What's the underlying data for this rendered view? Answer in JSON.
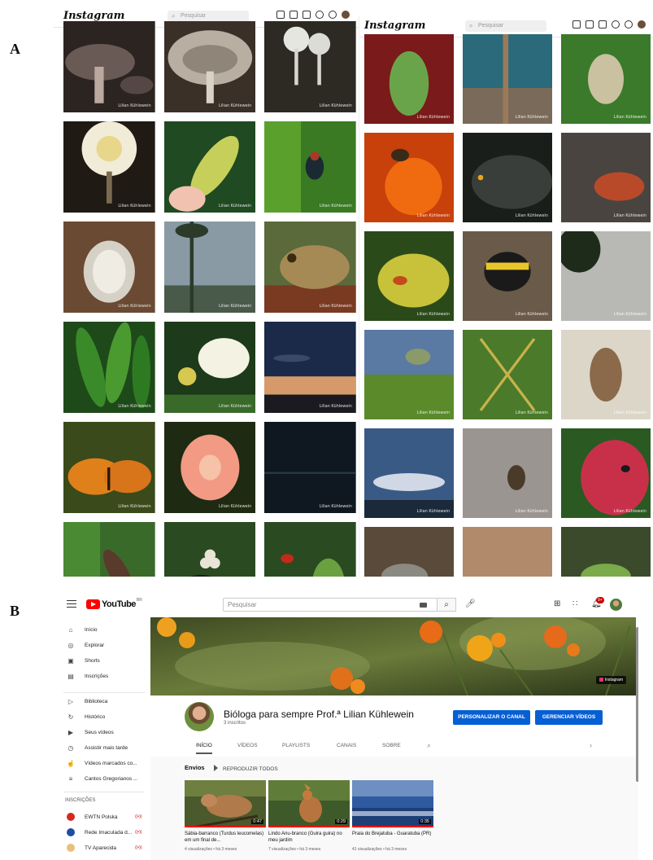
{
  "panels": {
    "a": "A",
    "b": "B"
  },
  "instagram": {
    "logo": "Instagram",
    "search_placeholder": "Pesquisar",
    "left_tiles": [
      {
        "id": "l1",
        "subject": "brown mushrooms",
        "watermark": "Lilian Kühlewein"
      },
      {
        "id": "l2",
        "subject": "mushroom gills",
        "watermark": "Lilian Kühlewein"
      },
      {
        "id": "l3",
        "subject": "white fungi",
        "watermark": "Lilian Kühlewein"
      },
      {
        "id": "l4",
        "subject": "white mushroom",
        "watermark": "Lilian Kühlewein"
      },
      {
        "id": "l5",
        "subject": "leaf in hand",
        "watermark": "Lilian Kühlewein"
      },
      {
        "id": "l6",
        "subject": "fly on leaf",
        "watermark": "Lilian Kühlewein"
      },
      {
        "id": "l7",
        "subject": "insect eggs",
        "watermark": "Lilian Kühlewein"
      },
      {
        "id": "l8",
        "subject": "palm and sky",
        "watermark": "Lilian Kühlewein"
      },
      {
        "id": "l9",
        "subject": "frog",
        "watermark": "Lilian Kühlewein"
      },
      {
        "id": "l10",
        "subject": "green leaves",
        "watermark": "Lilian Kühlewein"
      },
      {
        "id": "l11",
        "subject": "white butterfly",
        "watermark": "Lilian Kühlewein"
      },
      {
        "id": "l12",
        "subject": "sunset sky",
        "watermark": "Lilian Kühlewein"
      },
      {
        "id": "l13",
        "subject": "orange butterfly",
        "watermark": "Lilian Kühlewein"
      },
      {
        "id": "l14",
        "subject": "pink flower",
        "watermark": "Lilian Kühlewein"
      },
      {
        "id": "l15",
        "subject": "dark night",
        "watermark": "Lilian Kühlewein"
      },
      {
        "id": "l16",
        "subject": "bug on stem",
        "watermark": "Lilian Kühlewein"
      },
      {
        "id": "l17",
        "subject": "beetle with eggs",
        "watermark": "Lilian Kühlewein"
      },
      {
        "id": "l18",
        "subject": "red insect",
        "watermark": "Lilian Kühlewein"
      }
    ],
    "right_tiles": [
      {
        "id": "r1",
        "subject": "green insect",
        "watermark": "Lilian Kühlewein"
      },
      {
        "id": "r2",
        "subject": "stick insect",
        "watermark": "Lilian Kühlewein"
      },
      {
        "id": "r3",
        "subject": "stink bug",
        "watermark": "Lilian Kühlewein"
      },
      {
        "id": "r4",
        "subject": "bee on orange flower",
        "watermark": "Lilian Kühlewein"
      },
      {
        "id": "r5",
        "subject": "dark leaf",
        "watermark": "Lilian Kühlewein"
      },
      {
        "id": "r6",
        "subject": "red fungus",
        "watermark": "Lilian Kühlewein"
      },
      {
        "id": "r7",
        "subject": "beetle on yellow leaf",
        "watermark": "Lilian Kühlewein"
      },
      {
        "id": "r8",
        "subject": "bumblebee",
        "watermark": "Lilian Kühlewein"
      },
      {
        "id": "r9",
        "subject": "tree silhouette",
        "watermark": "Lilian Kühlewein"
      },
      {
        "id": "r10",
        "subject": "bird on branch",
        "watermark": "Lilian Kühlewein"
      },
      {
        "id": "r11",
        "subject": "spider",
        "watermark": "Lilian Kühlewein"
      },
      {
        "id": "r12",
        "subject": "moth",
        "watermark": "Lilian Kühlewein"
      },
      {
        "id": "r13",
        "subject": "clouds",
        "watermark": "Lilian Kühlewein"
      },
      {
        "id": "r14",
        "subject": "spider on wall",
        "watermark": "Lilian Kühlewein"
      },
      {
        "id": "r15",
        "subject": "spider on pink bud",
        "watermark": "Lilian Kühlewein"
      },
      {
        "id": "r16",
        "subject": "gecko",
        "watermark": "Lilian Kühlewein"
      },
      {
        "id": "r17",
        "subject": "wasp",
        "watermark": "Lilian Kühlewein"
      },
      {
        "id": "r18",
        "subject": "plant sprout",
        "watermark": "Lilian Kühlewein"
      }
    ]
  },
  "youtube": {
    "logo": "YouTube",
    "region": "BR",
    "search_placeholder": "Pesquisar",
    "notification_count": "9+",
    "sidebar": {
      "main": [
        {
          "label": "Início",
          "icon": "home-icon"
        },
        {
          "label": "Explorar",
          "icon": "compass-icon"
        },
        {
          "label": "Shorts",
          "icon": "shorts-icon"
        },
        {
          "label": "Inscrições",
          "icon": "subscriptions-icon"
        }
      ],
      "library": [
        {
          "label": "Biblioteca",
          "icon": "library-icon"
        },
        {
          "label": "Histórico",
          "icon": "history-icon"
        },
        {
          "label": "Seus vídeos",
          "icon": "your-videos-icon"
        },
        {
          "label": "Assistir mais tarde",
          "icon": "watch-later-icon"
        },
        {
          "label": "Vídeos marcados co...",
          "icon": "liked-icon"
        },
        {
          "label": "Cantos Gregorianos ...",
          "icon": "playlist-icon"
        }
      ],
      "subs_heading": "INSCRIÇÕES",
      "subscriptions": [
        {
          "label": "EWTN Polska",
          "color": "#d6281f"
        },
        {
          "label": "Rede Imaculada d...",
          "color": "#1d4ea3"
        },
        {
          "label": "TV Aparecida",
          "color": "#e8c07a"
        }
      ]
    },
    "channel": {
      "name": "Bióloga para sempre Prof.ª Lilian Kühlewein",
      "subscribers": "3 inscritos",
      "customize_button": "PERSONALIZAR O CANAL",
      "manage_button": "GERENCIAR VÍDEOS",
      "banner_link": "Instagram",
      "tabs": [
        "INÍCIO",
        "VÍDEOS",
        "PLAYLISTS",
        "CANAIS",
        "SOBRE"
      ],
      "active_tab": "INÍCIO"
    },
    "uploads": {
      "heading": "Envios",
      "play_all": "REPRODUZIR TODOS",
      "videos": [
        {
          "title": "Sábia-barranco (Turdus leucomelas) em um final de...",
          "meta": "4 visualizações • há 3 meses",
          "duration": "0:47"
        },
        {
          "title": "Lindo Anu-branco (Guira guira) no meu jardim",
          "meta": "7 visualizações • há 3 meses",
          "duration": "0:29"
        },
        {
          "title": "Praia do Brejatuba - Guaratuba (PR)",
          "meta": "41 visualizações • há 3 meses",
          "duration": "0:35"
        }
      ]
    }
  }
}
